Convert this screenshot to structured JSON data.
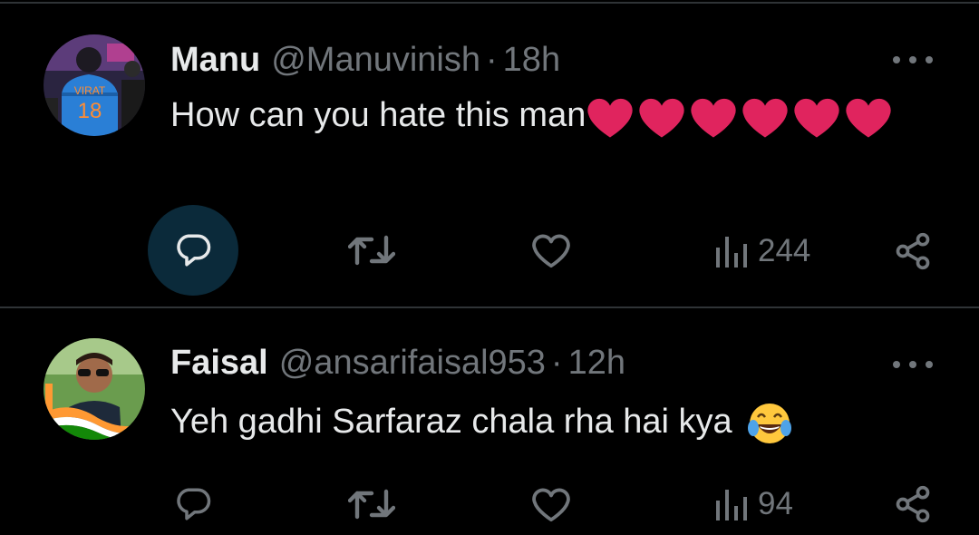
{
  "tweets": [
    {
      "name": "Manu",
      "handle": "@Manuvinish",
      "separator": "·",
      "time": "18h",
      "text": "How can you hate this man",
      "emoji": "heart-emoji",
      "emoji_count": 6,
      "views": "244",
      "avatar_jersey_text": "VIRAT",
      "avatar_jersey_number": "18"
    },
    {
      "name": "Faisal",
      "handle": "@ansarifaisal953",
      "separator": "·",
      "time": "12h",
      "text": "Yeh gadhi Sarfaraz chala rha hai kya",
      "emoji": "tears-of-joy-emoji",
      "views": "94"
    }
  ],
  "icons": {
    "reply": "reply-icon",
    "retweet": "retweet-icon",
    "like": "like-icon",
    "views": "views-icon",
    "share": "share-icon",
    "more": "more-icon"
  },
  "colors": {
    "background": "#000000",
    "text": "#e7e9ea",
    "muted": "#71767b",
    "heart": "#e0245e",
    "reply_highlight": "#0b2a3a"
  }
}
